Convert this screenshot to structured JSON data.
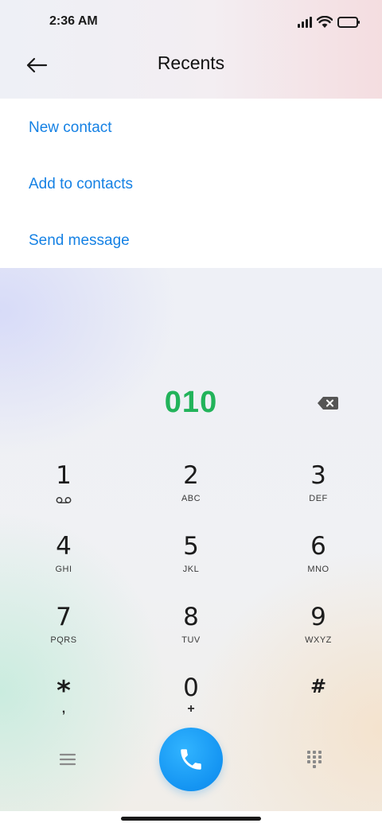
{
  "status_bar": {
    "time": "2:36 AM"
  },
  "header": {
    "title": "Recents"
  },
  "menu": {
    "items": [
      {
        "label": "New contact"
      },
      {
        "label": "Add to contacts"
      },
      {
        "label": "Send message"
      }
    ]
  },
  "dialer": {
    "number": "010",
    "keys": [
      {
        "digit": "1",
        "letters": ""
      },
      {
        "digit": "2",
        "letters": "ABC"
      },
      {
        "digit": "3",
        "letters": "DEF"
      },
      {
        "digit": "4",
        "letters": "GHI"
      },
      {
        "digit": "5",
        "letters": "JKL"
      },
      {
        "digit": "6",
        "letters": "MNO"
      },
      {
        "digit": "7",
        "letters": "PQRS"
      },
      {
        "digit": "8",
        "letters": "TUV"
      },
      {
        "digit": "9",
        "letters": "WXYZ"
      },
      {
        "digit": "*",
        "letters": ","
      },
      {
        "digit": "0",
        "letters": "+"
      },
      {
        "digit": "#",
        "letters": ""
      }
    ]
  },
  "colors": {
    "accent_blue": "#1581e4",
    "number_green": "#22b35a",
    "call_button": "#1494f2"
  },
  "icons": {
    "back": "arrow-left-icon",
    "backspace": "backspace-icon",
    "voicemail": "voicemail-icon",
    "menu": "hamburger-menu-icon",
    "call": "phone-icon",
    "keypad": "dialpad-icon"
  }
}
